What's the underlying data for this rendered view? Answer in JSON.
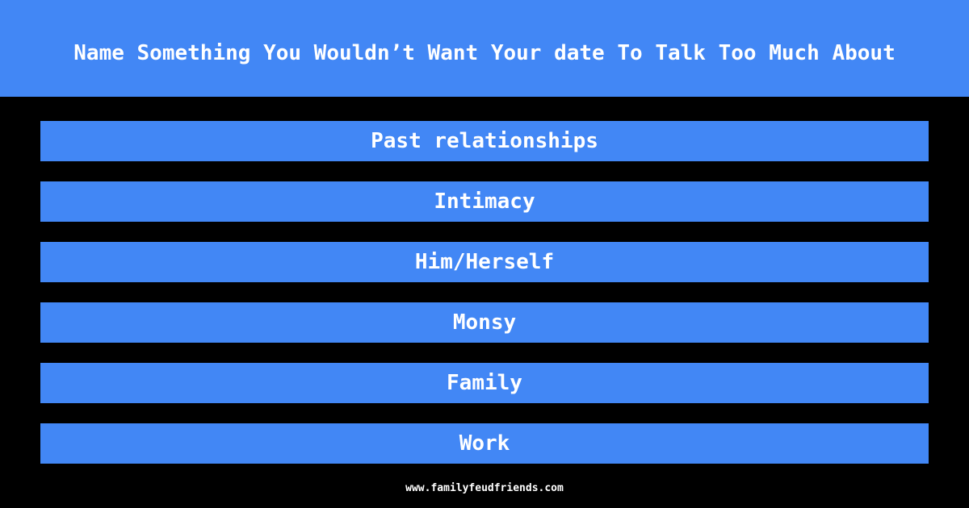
{
  "question": "Name Something You Wouldn’t Want Your date To Talk Too Much About",
  "answers": [
    "Past relationships",
    "Intimacy",
    "Him/Herself",
    "Monsy",
    "Family",
    "Work"
  ],
  "footer": "www.familyfeudfriends.com",
  "colors": {
    "accent": "#4287f5",
    "background": "#000000",
    "text": "#ffffff"
  }
}
